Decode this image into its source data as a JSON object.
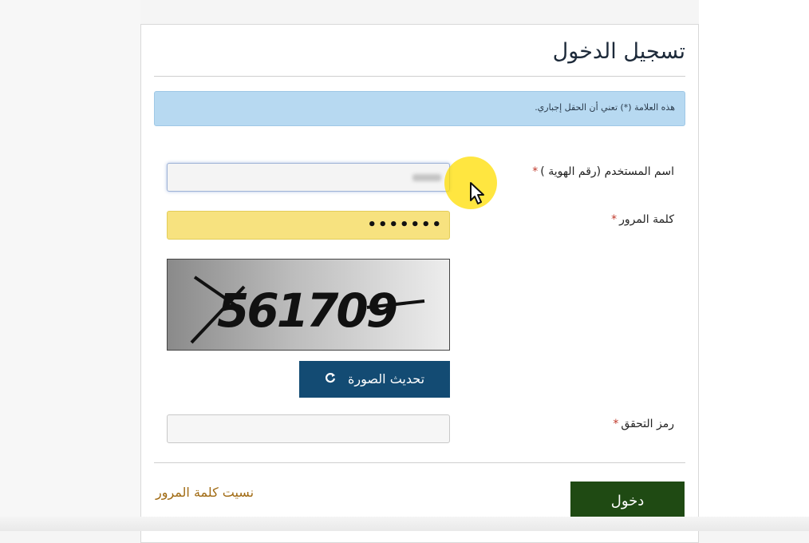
{
  "login": {
    "title": "تسجيل الدخول",
    "required_notice": "هذه العلامة (*) تعني أن الحقل إجباري.",
    "username_label": "اسم المستخدم (رقم الهوية )",
    "password_label": "كلمة المرور",
    "password_value": "•••••••",
    "captcha_text": "561709",
    "refresh_label": "تحديث الصورة",
    "captcha_label": "رمز التحقق",
    "login_label": "دخول",
    "forgot_label": "نسيت كلمة المرور",
    "required_marker": "*"
  },
  "colors": {
    "notice_bg": "#b7d9f1",
    "refresh_btn": "#134b73",
    "login_btn": "#1f4a13",
    "forgot_link": "#a06a12",
    "password_bg": "#f7e27f",
    "cursor_highlight": "#ffdd00"
  },
  "icons": {
    "refresh": "refresh-icon",
    "cursor": "mouse-pointer-icon"
  }
}
